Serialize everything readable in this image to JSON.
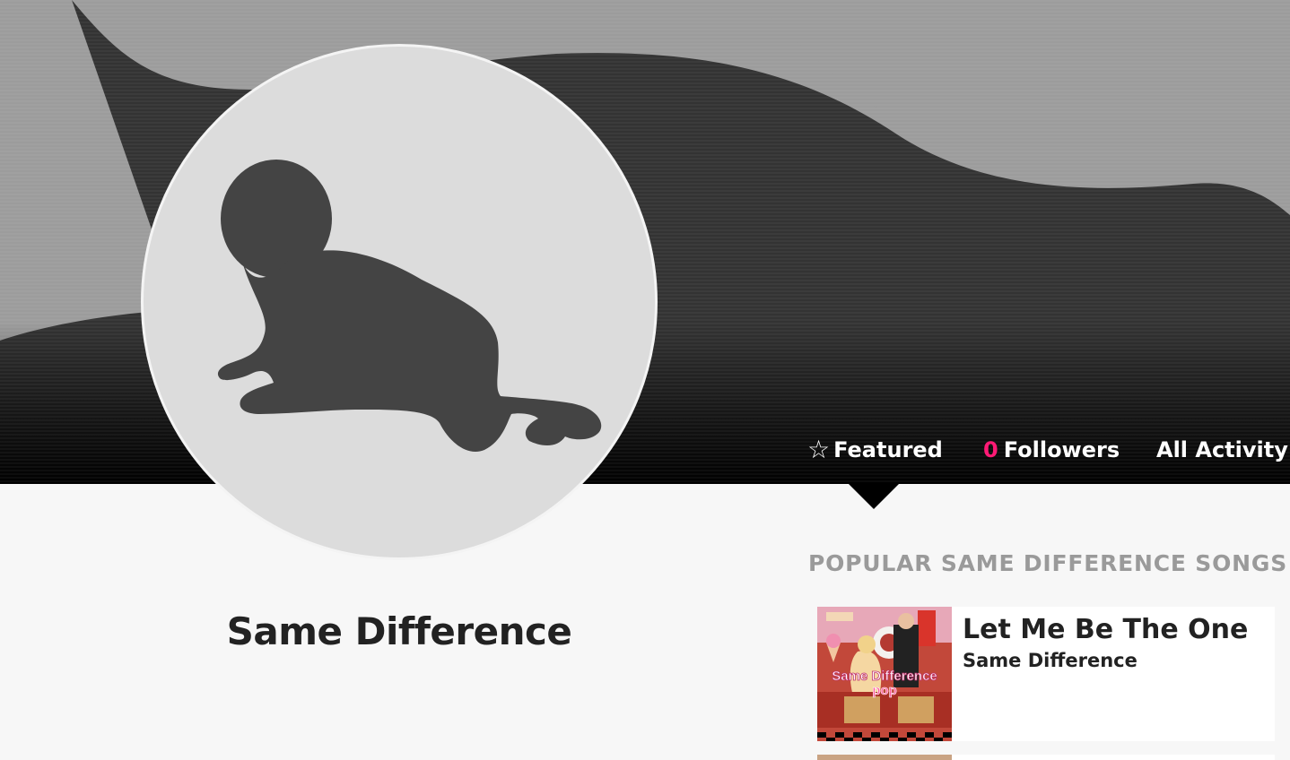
{
  "artist": {
    "name": "Same Difference"
  },
  "tabs": {
    "featured_label": "Featured",
    "featured_icon": "star-outline-icon",
    "followers_count": "0",
    "followers_label": "Followers",
    "activity_label": "All Activity"
  },
  "popular": {
    "section_title": "POPULAR SAME DIFFERENCE SONGS",
    "songs": [
      {
        "title": "Let Me Be The One",
        "artist": "Same Difference",
        "cover_text_top": "Same Difference",
        "cover_text_bottom": "pop"
      }
    ]
  },
  "colors": {
    "accent_pink": "#ff1a75",
    "banner_dark": "#333333",
    "banner_light": "#9c9c9c"
  }
}
